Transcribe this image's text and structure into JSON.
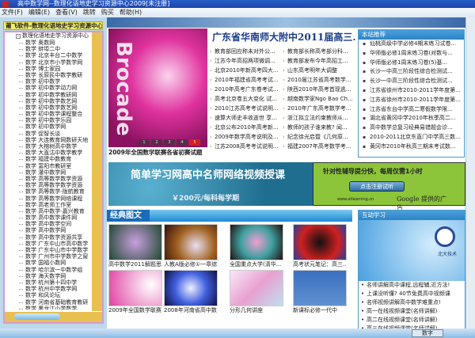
{
  "window": {
    "title": "高中数学网--数理化语地史学习资源中心2009[未注册]"
  },
  "menu": [
    "文件(F)",
    "编辑(E)",
    "查看(V)",
    "跳转",
    "购买",
    "帮助(H)"
  ],
  "sidebar": {
    "header": "莆飞软件-数理化语地史学习资源中心",
    "root": "数理化语地史学习资源中心",
    "items": [
      "数学 奥数网",
      "数学 蚌埠二中",
      "数学 北京丰台二中数学",
      "数学 北京市小学数学网",
      "数学 博士家园",
      "数学 长原民中数学教研",
      "数学 初中数学",
      "数学 初中数学动力网",
      "数学 初中数学教研网",
      "数学 初中数学数艺网",
      "数学 初中数学数艺网",
      "数学 初中数学课程整合",
      "数学 初中数学乐园",
      "数学 初中数学网",
      "数学 促智长谈",
      "数学 大连教育网数研天地",
      "数学 大榕树高中数学",
      "数学 大直沽中数学教学",
      "数学 福建中数教育",
      "数学 富阳市教研室",
      "数学 灌中数学网",
      "数学 高等数学数学资源",
      "数学 高等数学数学资源",
      "数学 高等数学-陇航教育",
      "数学 高等数学网络课程",
      "数学 高老师工作室",
      "数学 高中数学-嘉兴教育",
      "数学 高中数学课件网",
      "数学 高中数学空间",
      "数学 高中数学网",
      "数学 高中数学资源共享",
      "数学 广东中山市高中数学",
      "数学 广东中山市中学数学",
      "数学 广州市中学数学之窗",
      "数学 国福小数网",
      "数学 哈尔滨一中数学组",
      "数学 海天数学网",
      "数学 杭州第十四中学",
      "数学 杭州中学数学网",
      "数学 和风论坛",
      "数学 河南省基础教育教研",
      "数学 黑龙江小学数学"
    ]
  },
  "slideshow": {
    "image_text": "Brocade",
    "pages": [
      "1",
      "2",
      "3",
      "4",
      "5"
    ],
    "caption": "2009年全国数学联赛各省初赛试题"
  },
  "headline": "广东省华南师大附中2011届高三.",
  "news": [
    "教育部回应称未对外公...",
    "教育部长称高考部分科...",
    "江苏今年高招两项微调...",
    "教育部发布今年高招工...",
    "北京2010年新高考四大...",
    "山东高考明年大调整",
    "2010年福建省高考考试...",
    "2010届江苏省高考数学...",
    "2010年高考广东卷考试...",
    "陕西2010年高考首现逃...",
    "高考北京卷五大变化 试...",
    "越南数学家Ngo Bao Ch...",
    "2010江苏高考考试说明...",
    "2010年广东高考数学考...",
    "速算大师史丰收逝世 享...",
    "浙江拟立法约束教师从...",
    "北京公布2010年高考新...",
    "教师的孩子谁来教? 闻...",
    "2009年数学高考说明及...",
    "纪念徐光启暨《几何原...",
    "江苏2008高考考试说明...",
    "福建2007年高考数学考..."
  ],
  "recommend": {
    "title": "本站推荐",
    "items": [
      "仙桃高级中学必修4期末练习试卷...",
      "华师版必修1周末练习卷(对数与...",
      "华师版必修1周末练习卷(5)基...",
      "长沙一中高三阶段性综合检测试...",
      "长沙一中高三阶段性综合检测试...",
      "江苏省徐州市2010-2011学年度第...",
      "江苏省徐州市2010-2011学年度第...",
      "江苏省东台中学高二寒假数学限...",
      "湖北省黄冈中学2010年秋季高二...",
      "高中数学总复习经典易错题会诊...",
      "2010-2011北京东直门中学高三数...",
      "黄冈市2010年秋高三期末考试数..."
    ]
  },
  "ad_left": {
    "title": "简单学习网高中名师网络视频授课",
    "price": "￥200元/每科每学期"
  },
  "ad_right": {
    "slogan": "针对性辅导提分快，每周仅需1小时",
    "button": "点击注册试听",
    "url": "www.etlearning.cn",
    "provider": "Google 提供的广告"
  },
  "gallery": {
    "title": "经典图文",
    "items": [
      "高中数学2011解题思...",
      "人教A版必修①一章综...",
      "全国重点大学(清华...",
      "高考状元笔记：高三...",
      "2009年全国数学联赛",
      "2008年河南省高中数",
      "分形几何讲座",
      "新课标必修一代中"
    ]
  },
  "interactive": {
    "title": "互动学习",
    "logo_text": "北大技术",
    "items": [
      "名师讲解高中课程,远程辅,近方法!",
      "上课没听懂? 40节免费高中视频课",
      "名师视频讲解高中数学难重点!",
      "高一在线视频课堂(名师讲解)",
      "高二在线视频课堂(名师讲解)",
      "高三在线视频课堂(名师讲解)"
    ]
  },
  "status": {
    "mode": "数字"
  }
}
